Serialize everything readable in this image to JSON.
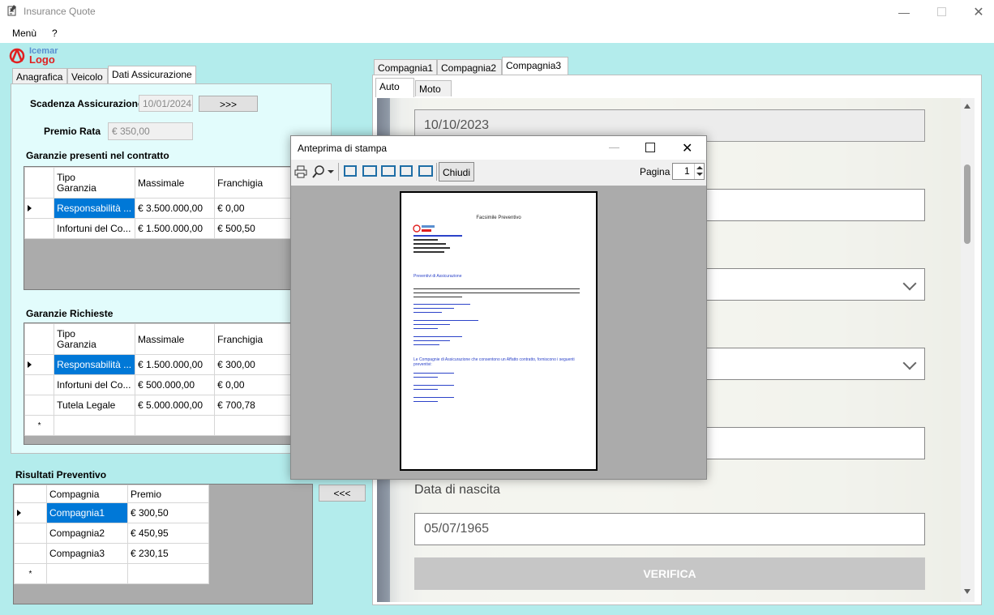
{
  "window": {
    "title": "Insurance Quote"
  },
  "menu": {
    "items": [
      "Menù",
      "?"
    ]
  },
  "logo": {
    "line1": "Icemar",
    "line2": "Logo"
  },
  "left_tabs": [
    "Anagrafica",
    "Veicolo",
    "Dati Assicurazione"
  ],
  "insurance": {
    "expiry_label": "Scadenza Assicurazione",
    "expiry_value": "10/01/2024",
    "next_button": ">>>",
    "premium_label": "Premio Rata",
    "premium_value": "€ 350,00"
  },
  "guarantees_present": {
    "title": "Garanzie presenti nel contratto",
    "columns": [
      "Tipo\nGaranzia",
      "Massimale",
      "Franchigia"
    ],
    "rows": [
      [
        "Responsabilità ...",
        "€ 3.500.000,00",
        "€ 0,00"
      ],
      [
        "Infortuni del Co...",
        "€ 1.500.000,00",
        "€ 500,50"
      ]
    ]
  },
  "guarantees_requested": {
    "title": "Garanzie Richieste",
    "columns": [
      "Tipo\nGaranzia",
      "Massimale",
      "Franchigia"
    ],
    "rows": [
      [
        "Responsabilità ...",
        "€ 1.500.000,00",
        "€ 300,00"
      ],
      [
        "Infortuni del Co...",
        "€ 500.000,00",
        "€ 0,00"
      ],
      [
        "Tutela Legale",
        "€ 5.000.000,00",
        "€ 700,78"
      ]
    ],
    "new_row_marker": "*"
  },
  "results": {
    "title": "Risultati Preventivo",
    "columns": [
      "Compagnia",
      "Premio"
    ],
    "rows": [
      [
        "Compagnia1",
        "€ 300,50"
      ],
      [
        "Compagnia2",
        "€ 450,95"
      ],
      [
        "Compagnia3",
        "€ 230,15"
      ]
    ],
    "new_row_marker": "*",
    "back_button": "<<<"
  },
  "company_tabs": [
    "Compagnia1",
    "Compagnia2",
    "Compagnia3"
  ],
  "vehicle_tabs": [
    "Auto",
    "Moto"
  ],
  "form": {
    "date_value": "10/10/2023",
    "birth_label": "Data di nascita",
    "birth_value": "05/07/1965",
    "verify_button": "VERIFICA"
  },
  "print_preview": {
    "title": "Anteprima di stampa",
    "close_label": "Chiudi",
    "page_label": "Pagina",
    "page_value": "1",
    "doc_title": "Facsimile Preventivo",
    "doc_section": "Preventivi di Assicurazione",
    "doc_footer": "Le Compagnie di Assicurazione che consentono un Affatto contratto, forniscono i seguenti preventivi:"
  }
}
